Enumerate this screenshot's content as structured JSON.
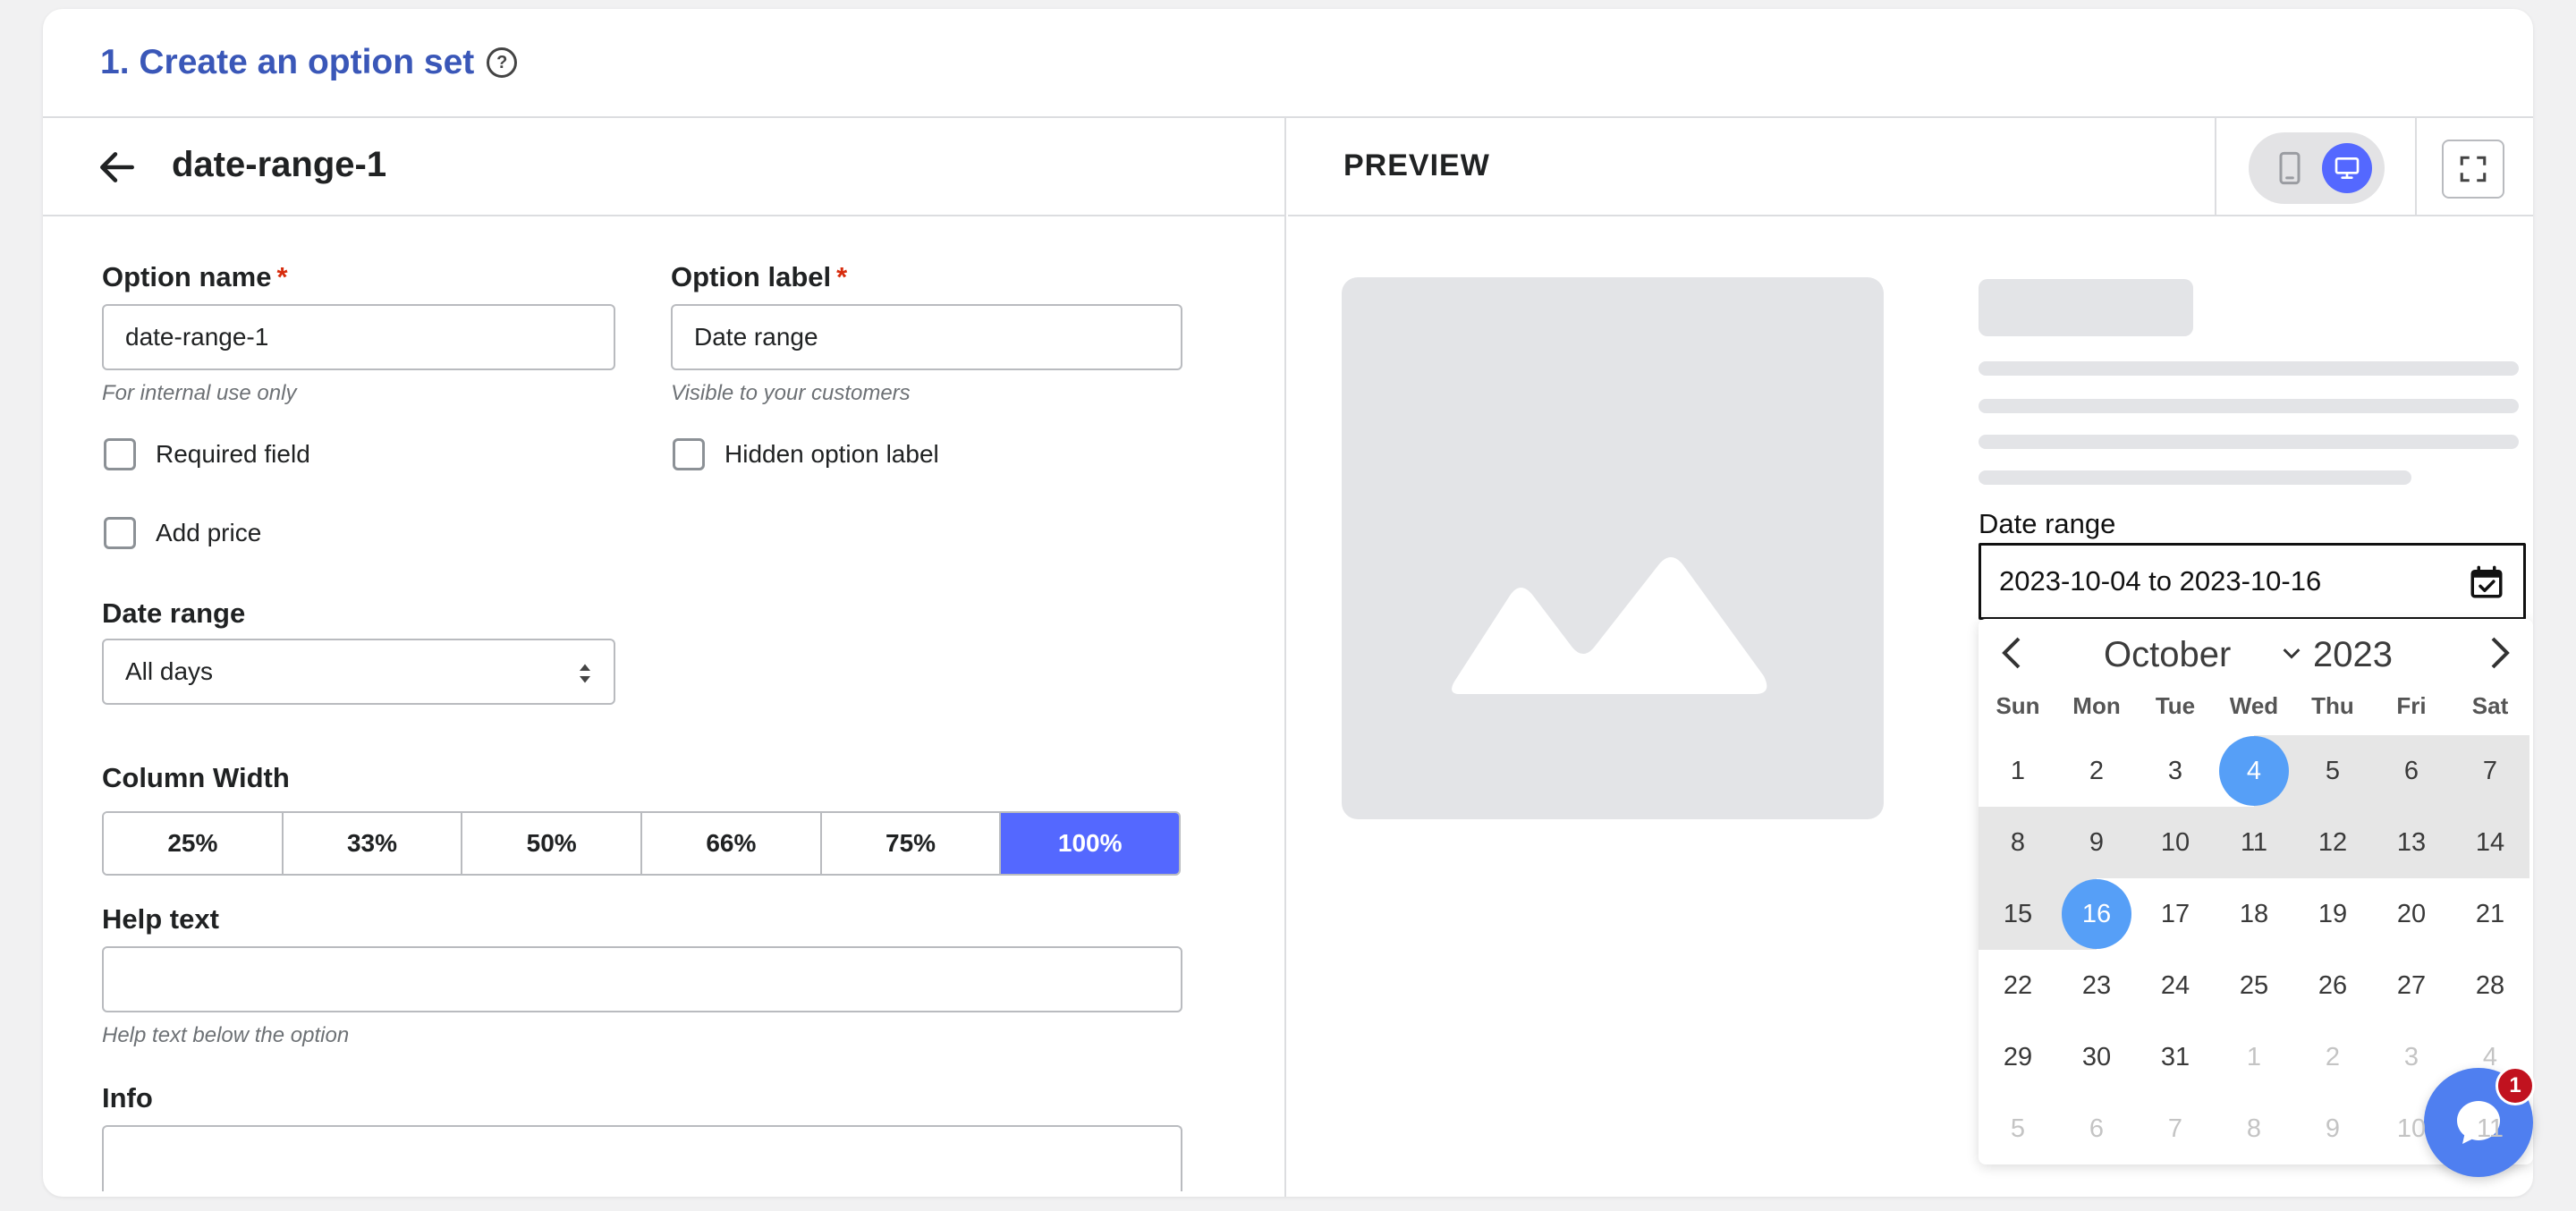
{
  "page": {
    "title": "1. Create an option set"
  },
  "editor": {
    "option_title": "date-range-1",
    "option_name": {
      "label": "Option name",
      "required_mark": "*",
      "value": "date-range-1",
      "hint": "For internal use only"
    },
    "option_label": {
      "label": "Option label",
      "required_mark": "*",
      "value": "Date range",
      "hint": "Visible to your customers"
    },
    "checkboxes": {
      "required": "Required field",
      "hidden_label": "Hidden option label",
      "add_price": "Add price"
    },
    "date_range": {
      "label": "Date range",
      "selected": "All days"
    },
    "column_width": {
      "label": "Column Width",
      "options": [
        "25%",
        "33%",
        "50%",
        "66%",
        "75%",
        "100%"
      ],
      "selected": "100%"
    },
    "help_text": {
      "label": "Help text",
      "value": "",
      "hint": "Help text below the option"
    },
    "info": {
      "label": "Info"
    }
  },
  "preview": {
    "title": "PREVIEW",
    "field_label": "Date range",
    "field_value": "2023-10-04 to 2023-10-16",
    "calendar": {
      "month": "October",
      "year": "2023",
      "weekdays": [
        "Sun",
        "Mon",
        "Tue",
        "Wed",
        "Thu",
        "Fri",
        "Sat"
      ],
      "weeks": [
        [
          "1",
          "2",
          "3",
          "4",
          "5",
          "6",
          "7"
        ],
        [
          "8",
          "9",
          "10",
          "11",
          "12",
          "13",
          "14"
        ],
        [
          "15",
          "16",
          "17",
          "18",
          "19",
          "20",
          "21"
        ],
        [
          "22",
          "23",
          "24",
          "25",
          "26",
          "27",
          "28"
        ],
        [
          "29",
          "30",
          "31",
          "1",
          "2",
          "3",
          "4"
        ],
        [
          "5",
          "6",
          "7",
          "8",
          "9",
          "10",
          "11"
        ]
      ],
      "range_start": "4",
      "range_end": "16"
    }
  },
  "chat": {
    "badge_count": "1"
  },
  "colors": {
    "accent": "#5468ff",
    "title_blue": "#3a57b8",
    "date_selected": "#569ff7",
    "range_bg": "#e6e6e6",
    "required": "#d72c0d"
  }
}
